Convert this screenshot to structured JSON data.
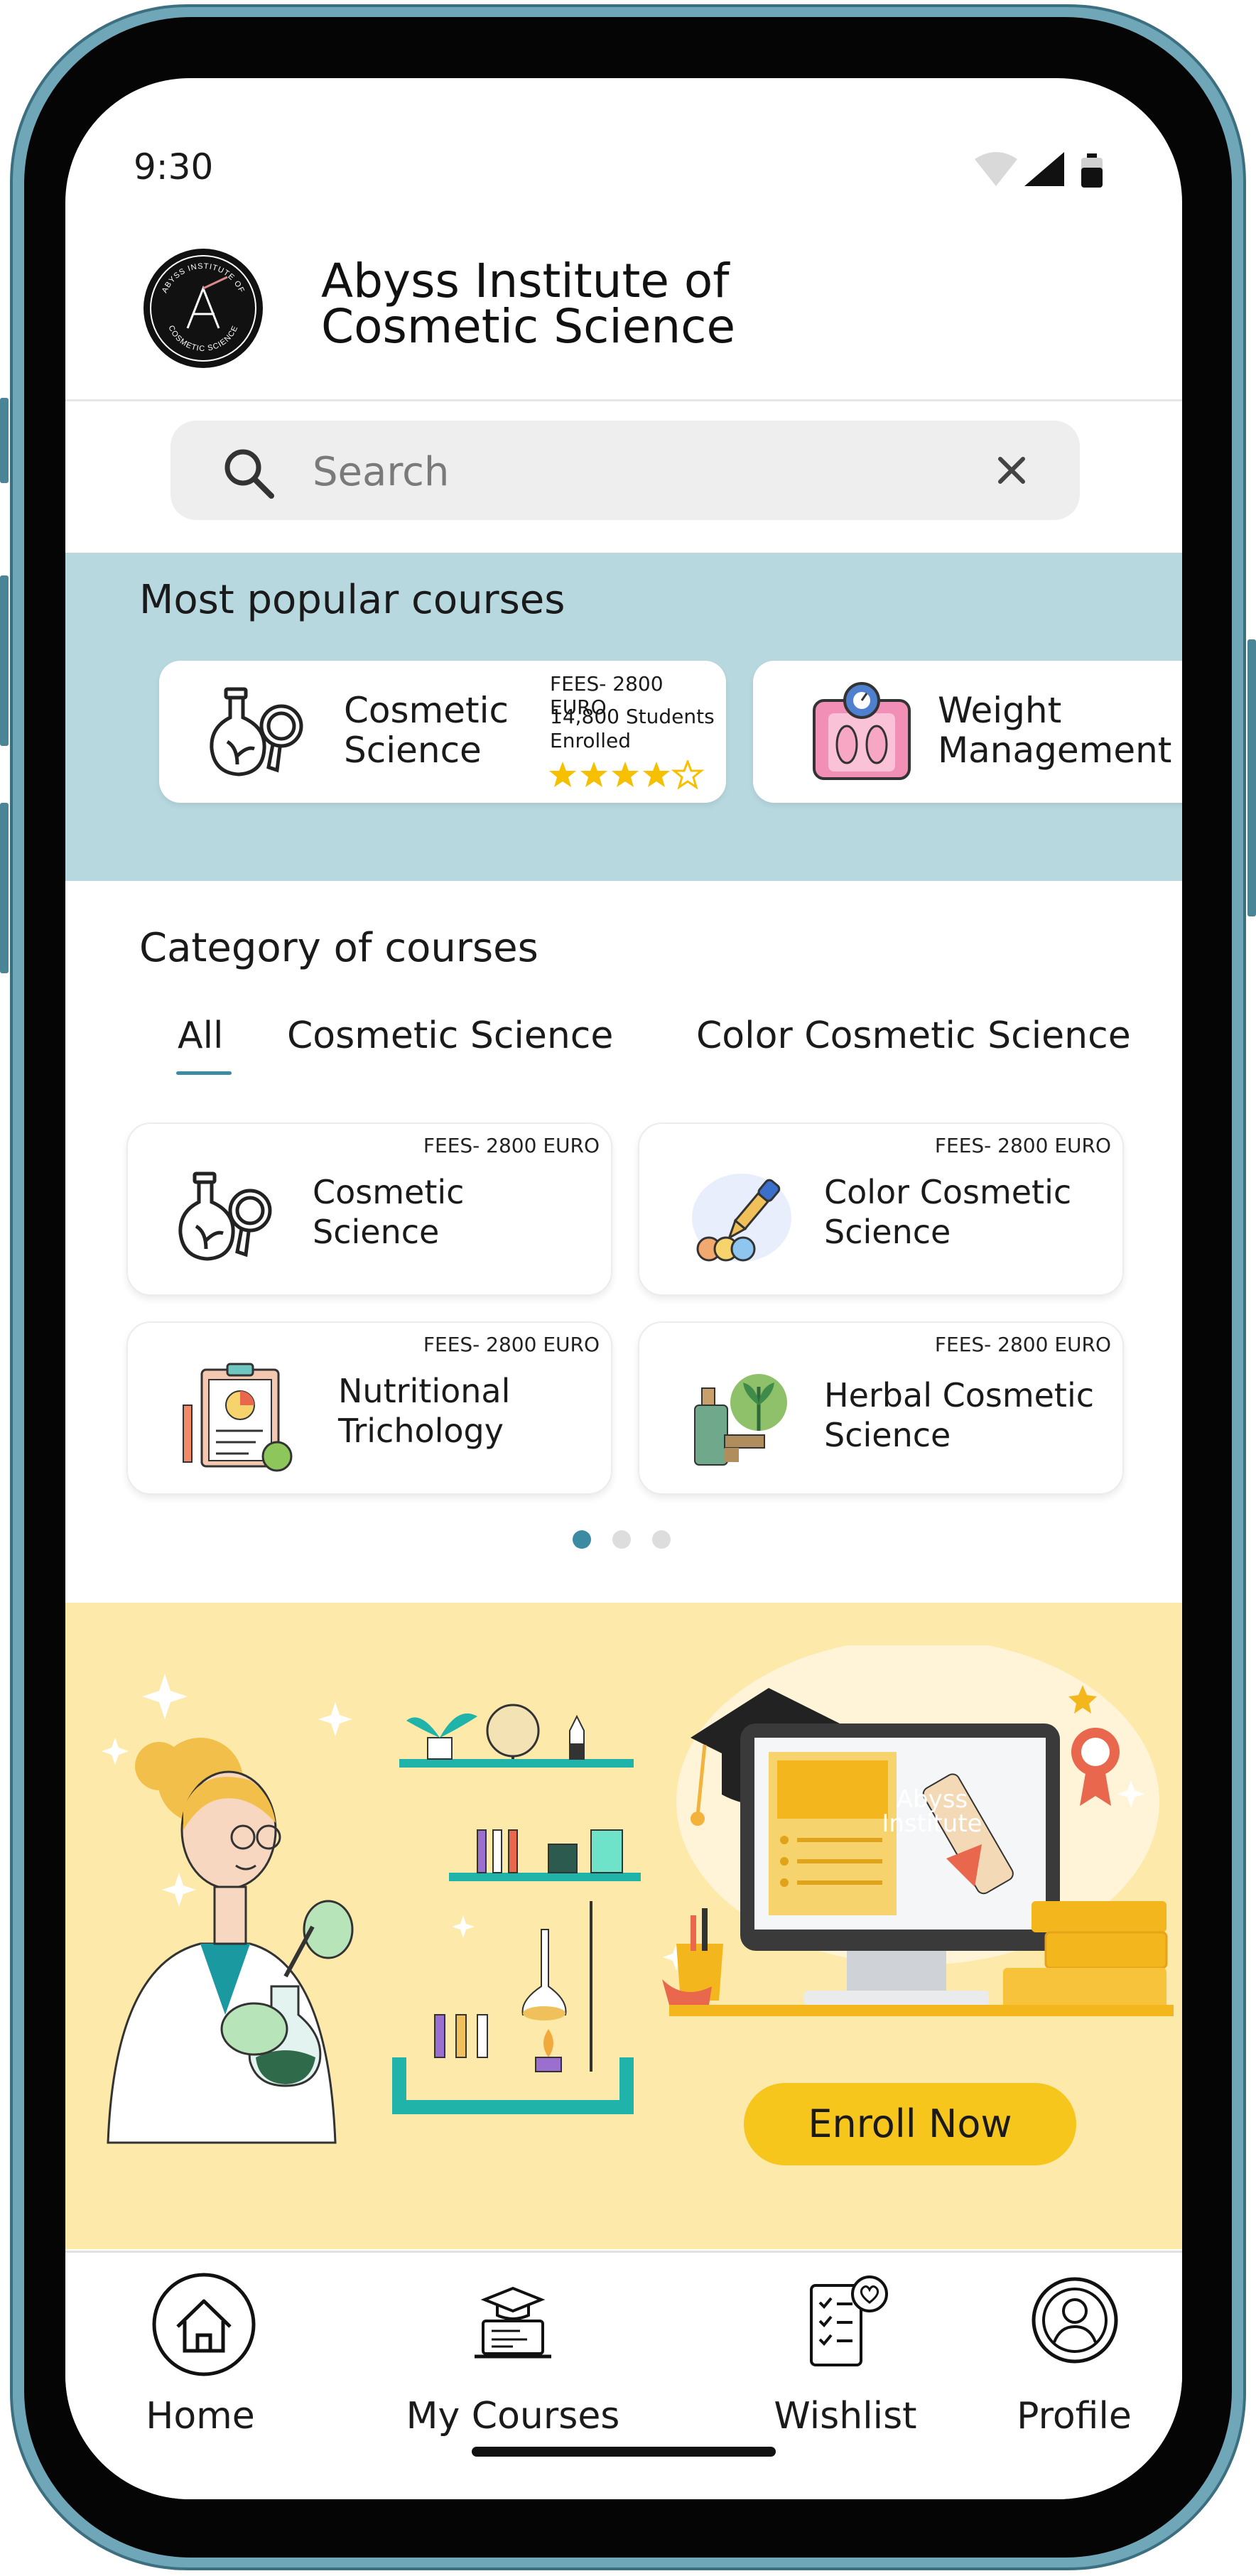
{
  "status_bar": {
    "time": "9:30"
  },
  "header": {
    "logo_text": "ABYSS INSTITUTE OF COSMETIC SCIENCE",
    "title_line1": "Abyss Institute of",
    "title_line2": "Cosmetic Science"
  },
  "search": {
    "placeholder": "Search"
  },
  "popular": {
    "title": "Most popular courses",
    "cards": [
      {
        "title_line1": "Cosmetic",
        "title_line2": "Science",
        "fees": "FEES- 2800 EURO",
        "students_line1": "14,800 Students",
        "students_line2": "Enrolled",
        "rating": 4.5
      },
      {
        "title_line1": "Weight",
        "title_line2": "Management"
      }
    ]
  },
  "category": {
    "title": "Category of courses",
    "tabs": [
      "All",
      "Cosmetic Science",
      "Color Cosmetic Science"
    ],
    "active_tab": "All",
    "courses": [
      {
        "fees": "FEES- 2800 EURO",
        "title_line1": "Cosmetic",
        "title_line2": "Science"
      },
      {
        "fees": "FEES- 2800 EURO",
        "title_line1": "Color Cosmetic",
        "title_line2": "Science"
      },
      {
        "fees": "FEES- 2800 EURO",
        "title_line1": "Nutritional",
        "title_line2": "Trichology"
      },
      {
        "fees": "FEES- 2800 EURO",
        "title_line1": "Herbal Cosmetic",
        "title_line2": "Science"
      }
    ],
    "pagination": {
      "pages": 3,
      "current": 1
    }
  },
  "banner": {
    "screen_title_line1": "Abyss",
    "screen_title_line2": "Institute",
    "button": "Enroll Now"
  },
  "bottom_nav": {
    "items": [
      {
        "label": "Home",
        "icon": "home-icon"
      },
      {
        "label": "My Courses",
        "icon": "graduation-laptop-icon"
      },
      {
        "label": "Wishlist",
        "icon": "checklist-heart-icon"
      },
      {
        "label": "Profile",
        "icon": "user-circle-icon"
      }
    ]
  },
  "colors": {
    "frame": "#6fa7b8",
    "popular_bg": "#b8d8e0",
    "banner_bg": "#fdeaaa",
    "accent_teal": "#3d8ba3",
    "button_yellow": "#f7c61d",
    "star": "#f6c000"
  }
}
